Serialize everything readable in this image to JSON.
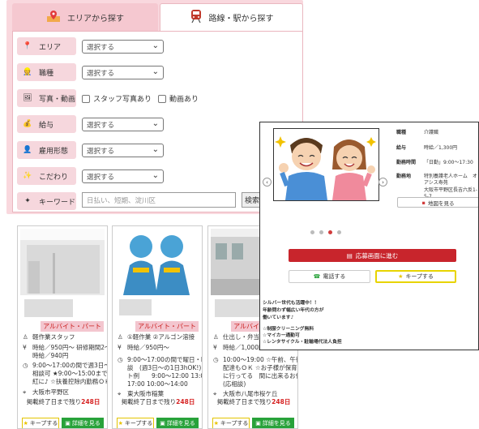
{
  "tabs": {
    "area": "エリアから探す",
    "line": "路線・駅から探す"
  },
  "form": {
    "rows": [
      {
        "label": "エリア",
        "type": "select",
        "value": "選択する"
      },
      {
        "label": "職種",
        "type": "select",
        "value": "選択する"
      },
      {
        "label": "写真・動画",
        "type": "checks",
        "options": [
          "スタッフ写真あり",
          "動画あり"
        ]
      },
      {
        "label": "給与",
        "type": "select",
        "value": "選択する"
      },
      {
        "label": "雇用形態",
        "type": "select",
        "value": "選択する"
      },
      {
        "label": "こだわり",
        "type": "select",
        "value": "選択する"
      },
      {
        "label": "キーワード",
        "type": "keyword"
      }
    ],
    "keyword_placeholder": "日払い、短期、淀川区",
    "search_label": "検索す"
  },
  "cards": [
    {
      "badge": "アルバイト・パート",
      "job": "軽作業スタッフ",
      "salary1": "時給／950円～ 研修期間2～3ヶ月",
      "salary2": "時給／940円",
      "time1": "9:00～17:00の間で週3日～・時間",
      "time2": "相談可 ★9:00～15:00まで働ける美",
      "time3": "紅に♪ ☆扶養控除内勤務ＯＫ",
      "place": "大阪市平野区",
      "posted_prefix": "掲載終了日まで残り",
      "posted_days": "248日",
      "keep": "キープする",
      "detail": "詳細を見る"
    },
    {
      "badge": "アルバイト・パート",
      "job": "①軽作業 ②アルゴン溶接",
      "salary1": "時給／950円～",
      "salary2": "",
      "time1": "9:00～17:00の間で曜日・時間は応",
      "time2": "談　(週3日～の1日3hOK!) ☆シフ",
      "time3": "ト例　　9:00～12:00 13:00～",
      "time4": "17:00 10:00～14:00",
      "place": "東大阪市稲葉",
      "posted_prefix": "掲載終了日まで残り",
      "posted_days": "248日",
      "keep": "キープする",
      "detail": "詳細を見る"
    },
    {
      "badge": "アルバイト・パート",
      "job": "仕出し・弁当配達スタッフ",
      "salary1": "時給／1,000円～",
      "salary2": "",
      "time1": "10:00～19:00 ☆午前、午後だけの",
      "time2": "配達もＯＫ ☆お子様が保育園や学校",
      "time3": "に行ってる　間に出来るお仕事です",
      "time4": "(応相談)",
      "place": "大阪市八尾市桜ケ丘",
      "posted_prefix": "掲載終了日まで残り",
      "posted_days": "248日",
      "keep": "キープする",
      "detail": "詳細を見る"
    }
  ],
  "popup": {
    "info": [
      {
        "k": "職種",
        "v": "介護職"
      },
      {
        "k": "給与",
        "v": "時給／1,300円"
      },
      {
        "k": "勤務時間",
        "v": "「日勤」9:00～17:30"
      },
      {
        "k": "勤務地",
        "v": "特別養護老人ホーム　オアシス寿苑"
      },
      {
        "k": "",
        "v": "大阪市平野区長吉六反1-5-7"
      }
    ],
    "map": "地図を見る",
    "apply": "応募画面に進む",
    "phone": "電話する",
    "keep": "キープする",
    "text": [
      "シルバー世代も活躍中！！",
      "年齢問わず幅広い年代の方が",
      "働いています♪",
      "",
      "☆制服クリーニング無料",
      "☆マイカー通勤可",
      "☆レンタサイクル・駐輪場代法人負担"
    ]
  },
  "colors": {
    "panel_bg": "#f9d8de",
    "label_bg": "#f6d7dd",
    "apply_red": "#c8252c",
    "detail_green": "#28a23a",
    "keep_yellow": "#e8d400",
    "badge_red": "#c22"
  }
}
